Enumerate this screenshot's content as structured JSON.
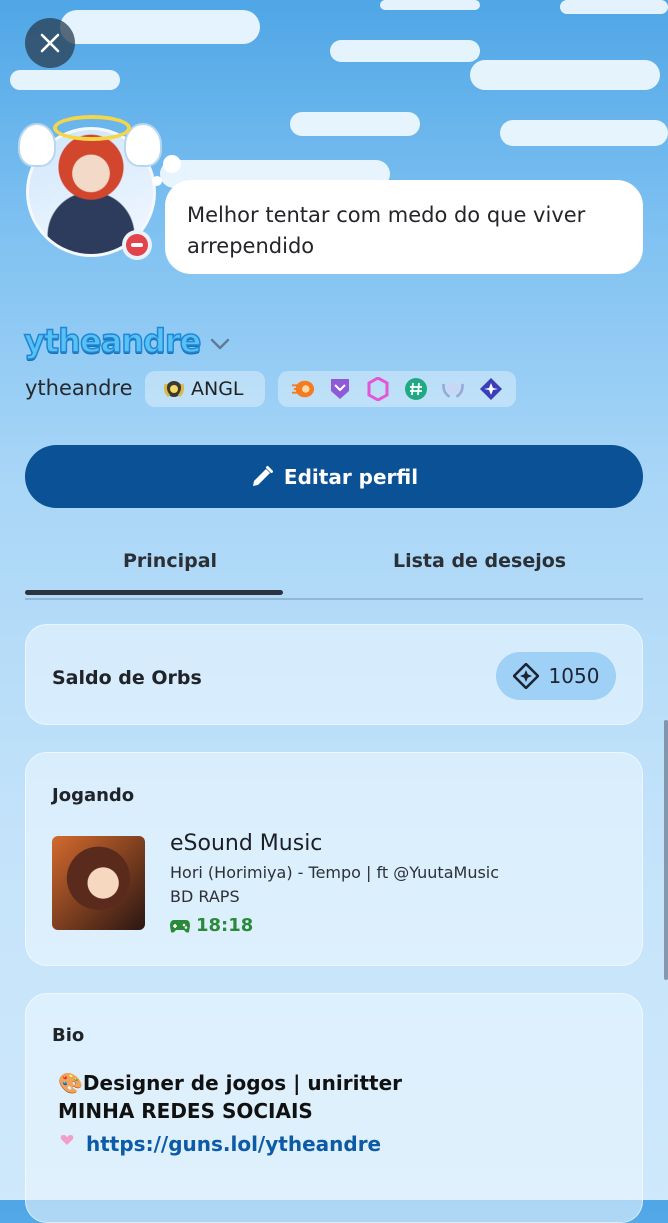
{
  "profile": {
    "status_message": "Melhor tentar com medo do que viver arrependido",
    "display_name": "ytheandre",
    "username": "ytheandre",
    "clan_tag": "ANGL",
    "badges": [
      "nitro-boost-badge",
      "shield-badge",
      "hexagon-badge",
      "hashtag-badge",
      "laurel-badge",
      "quest-badge"
    ]
  },
  "actions": {
    "edit_profile": "Editar perfil"
  },
  "tabs": [
    {
      "label": "Principal",
      "active": true
    },
    {
      "label": "Lista de desejos",
      "active": false
    }
  ],
  "orbs": {
    "label": "Saldo de Orbs",
    "value": "1050"
  },
  "activity": {
    "label": "Jogando",
    "title": "eSound Music",
    "line1": "Hori (Horimiya) - Tempo | ft @YuutaMusic",
    "line2": "BD RAPS",
    "time": "18:18"
  },
  "bio": {
    "label": "Bio",
    "line1": "🎨Designer de jogos | uniritter",
    "line2": "MINHA REDES SOCIAIS",
    "link": "https://guns.lol/ytheandre"
  },
  "colors": {
    "accent": "#0a5196",
    "display_name": "#58c2f5",
    "dnd_status": "#e3434b",
    "activity_time": "#2a8a3a",
    "link": "#0d5aa6"
  }
}
